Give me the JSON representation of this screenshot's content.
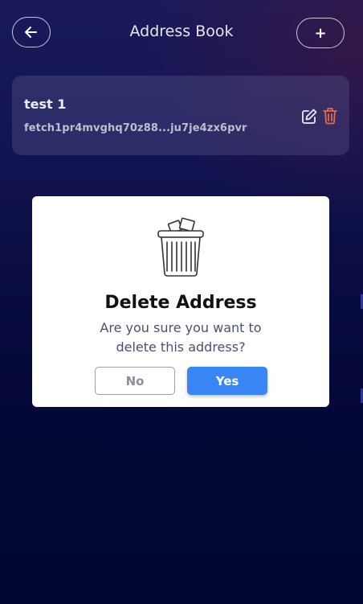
{
  "header": {
    "title": "Address Book",
    "back_icon": "arrow-left-icon",
    "add_label": "+"
  },
  "addresses": [
    {
      "name": "test 1",
      "address": "fetch1pr4mvghq70z88...ju7je4zx6pvr",
      "edit_icon": "edit-icon",
      "delete_icon": "trash-icon"
    }
  ],
  "dialog": {
    "icon": "trash-bin-icon",
    "title": "Delete Address",
    "message": "Are you sure you want to delete this address?",
    "cancel_label": "No",
    "confirm_label": "Yes"
  },
  "colors": {
    "accent": "#3a86f5",
    "delete": "#e56a4a",
    "background": "#020731"
  }
}
